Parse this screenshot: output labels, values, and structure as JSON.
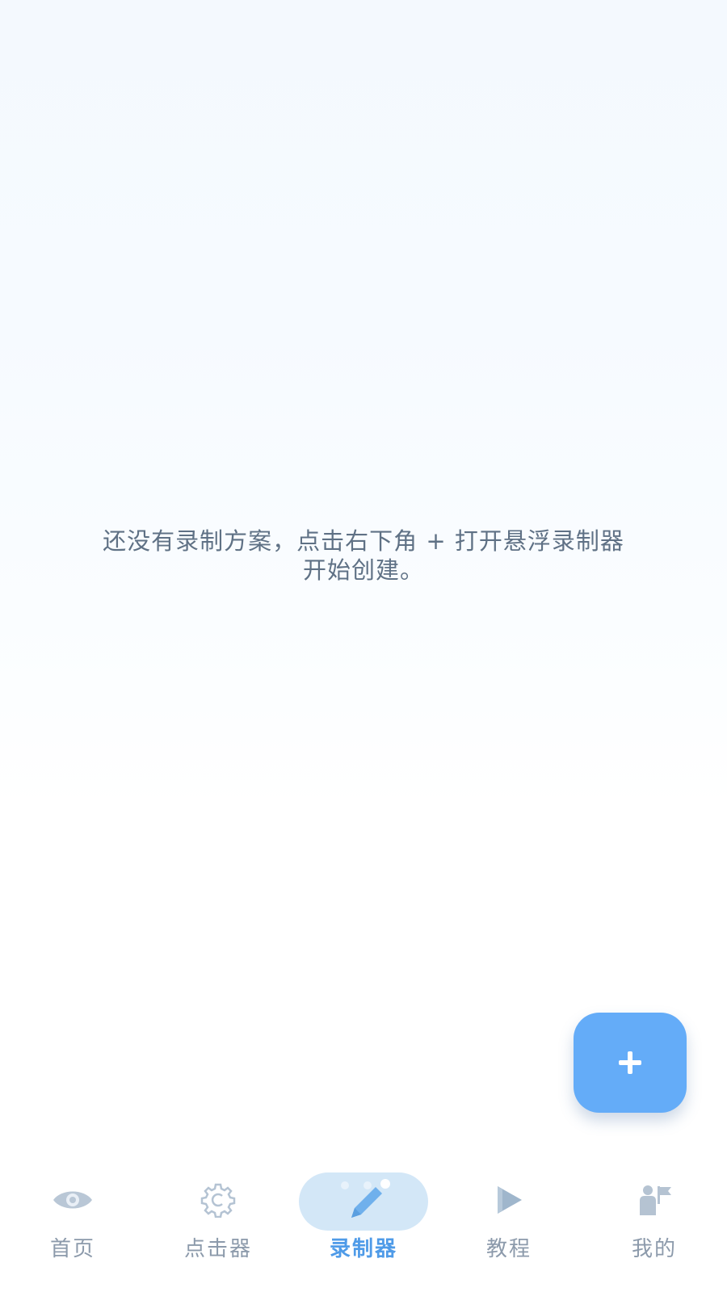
{
  "empty_state": {
    "line1": "还没有录制方案，点击右下角 + 打开悬浮录制器",
    "line2": "开始创建。"
  },
  "fab": {
    "icon": "plus-icon",
    "color": "#64acf8"
  },
  "bottom_nav": {
    "active_index": 2,
    "active_color": "#4f9be8",
    "inactive_color": "#8c9aab",
    "items": [
      {
        "label": "首页",
        "icon": "eye-icon"
      },
      {
        "label": "点击器",
        "icon": "gear-c-icon"
      },
      {
        "label": "录制器",
        "icon": "pen-icon"
      },
      {
        "label": "教程",
        "icon": "play-icon"
      },
      {
        "label": "我的",
        "icon": "person-flag-icon"
      }
    ]
  }
}
